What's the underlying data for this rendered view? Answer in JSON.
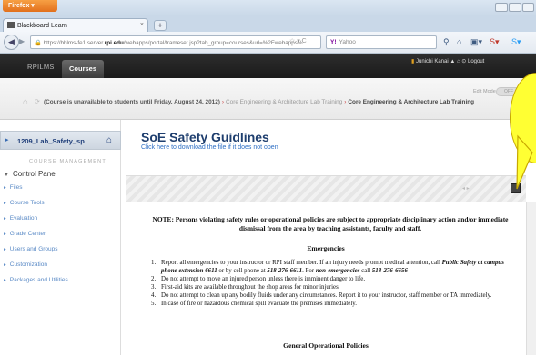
{
  "browser": {
    "menu_label": "Firefox ▾",
    "tab_title": "Blackboard Learn",
    "url_prefix": "https://bblms-fe1.server.",
    "url_domain": "rpi.edu",
    "url_suffix": "/webapps/portal/frameset.jsp?tab_group=courses&url=%2Fwebapps%",
    "search_engine": "Y!",
    "search_placeholder": "Yahoo"
  },
  "bb_header": {
    "tab_left": "RPILMS",
    "tab_active": "Courses",
    "user_text": "Junichi Kanai",
    "logout": "Logout"
  },
  "breadcrumb": {
    "course_prefix": "(Course is unavailable to students until Friday, August 24, 2012)",
    "item1": "Core Engineering & Architecture Lab Training",
    "item2": "Core Engineering & Architecture Lab Training",
    "edit_mode_label": "Edit Mode is:",
    "edit_mode_state": "OFF"
  },
  "sidebar": {
    "course_name": "1209_Lab_Safety_sp",
    "section_title": "COURSE MANAGEMENT",
    "control_panel": "Control Panel",
    "items": [
      "Files",
      "Course Tools",
      "Evaluation",
      "Grade Center",
      "Users and Groups",
      "Customization",
      "Packages and Utilities"
    ]
  },
  "content": {
    "title": "SoE Safety Guidlines",
    "download_link": "Click here to download the file if it does not open",
    "note": "NOTE: Persons violating safety rules or operational policies are subject to appropriate disciplinary action and/or immediate dismissal from the area by teaching assistants, faculty and staff.",
    "emergencies_heading": "Emergencies",
    "list": [
      {
        "num": "1.",
        "a": "Report all emergencies to your instructor or RPI staff member. If an injury needs prompt medical attention, call ",
        "b": "Public Safety at campus phone extension 6611",
        "c": " or by cell phone at ",
        "d": "518-276-6611",
        "e": ". For ",
        "f": "non-emergencies",
        "g": " call ",
        "h": "518-276-6656"
      },
      {
        "num": "2.",
        "text": "Do not attempt to move an injured person unless there is imminent danger to life."
      },
      {
        "num": "3.",
        "text": "First-aid kits are available throughout the shop areas for minor injuries."
      },
      {
        "num": "4.",
        "text": "Do not attempt to clean up any bodily fluids under any circumstances. Report it to your instructor, staff member or TA immediately."
      },
      {
        "num": "5.",
        "text": "In case of fire or hazardous chemical spill evacuate the premises immediately."
      }
    ],
    "general_heading": "General Operational Policies"
  },
  "colors": {
    "callout_fill": "#ffff33",
    "title_blue": "#1e3e6e",
    "link_blue": "#2e6fc4"
  }
}
